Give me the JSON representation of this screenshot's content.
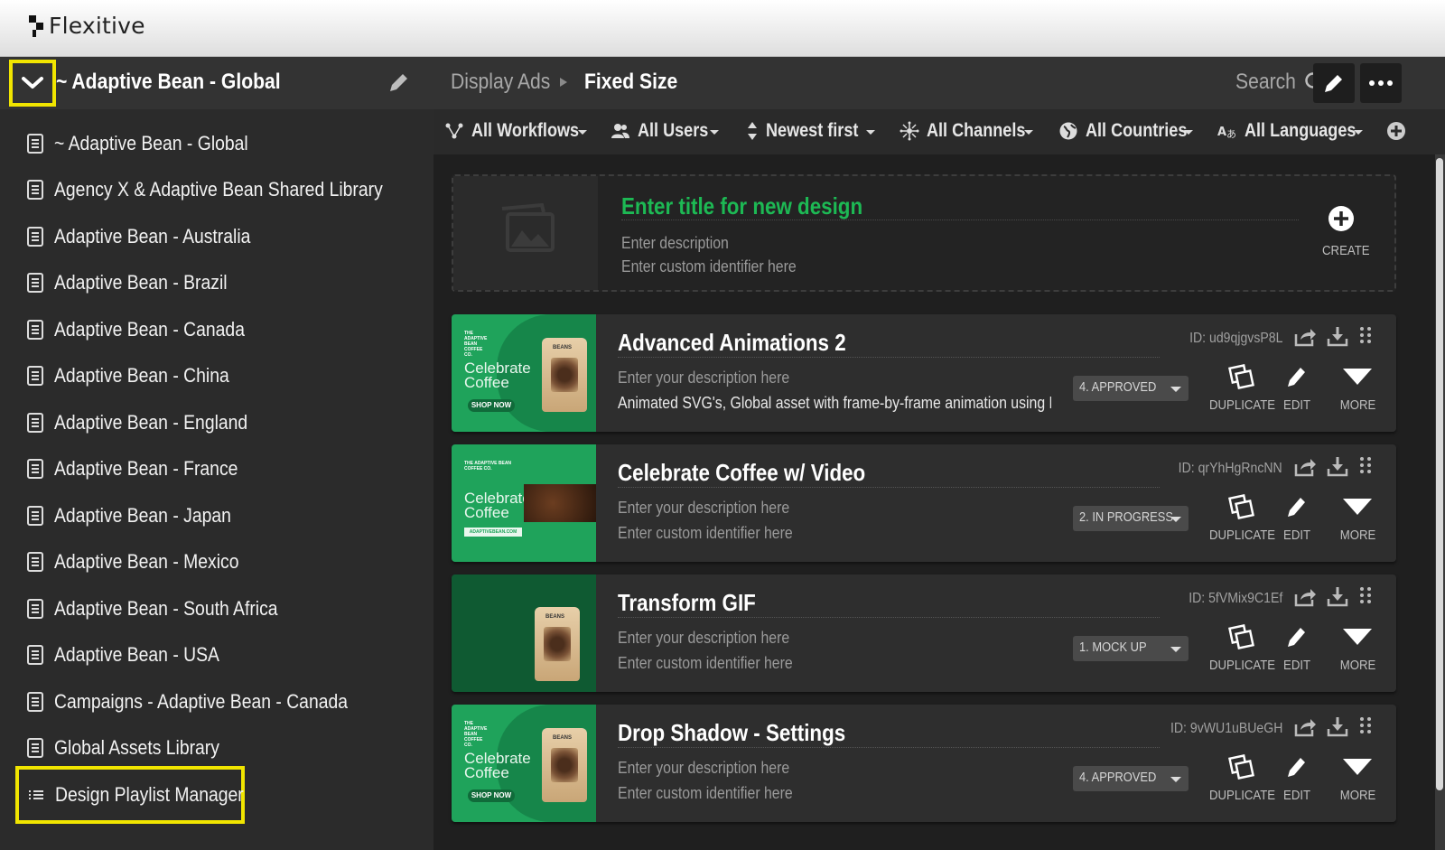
{
  "app": {
    "logo_text": "Flexitive"
  },
  "sidebar": {
    "header_title": "~ Adaptive Bean - Global",
    "items": [
      {
        "label": "~ Adaptive Bean - Global",
        "icon": "document-icon"
      },
      {
        "label": "Agency X & Adaptive Bean Shared Library",
        "icon": "document-icon"
      },
      {
        "label": "Adaptive Bean - Australia",
        "icon": "document-icon"
      },
      {
        "label": "Adaptive Bean - Brazil",
        "icon": "document-icon"
      },
      {
        "label": "Adaptive Bean - Canada",
        "icon": "document-icon"
      },
      {
        "label": "Adaptive Bean - China",
        "icon": "document-icon"
      },
      {
        "label": "Adaptive Bean - England",
        "icon": "document-icon"
      },
      {
        "label": "Adaptive Bean - France",
        "icon": "document-icon"
      },
      {
        "label": "Adaptive Bean - Japan",
        "icon": "document-icon"
      },
      {
        "label": "Adaptive Bean - Mexico",
        "icon": "document-icon"
      },
      {
        "label": "Adaptive Bean - South Africa",
        "icon": "document-icon"
      },
      {
        "label": "Adaptive Bean - USA",
        "icon": "document-icon"
      },
      {
        "label": "Campaigns - Adaptive Bean - Canada",
        "icon": "document-icon"
      },
      {
        "label": "Global Assets Library",
        "icon": "document-icon"
      },
      {
        "label": "Design Playlist Manager",
        "icon": "list-icon"
      }
    ]
  },
  "header": {
    "breadcrumb": [
      "Display Ads",
      "Fixed Size"
    ],
    "search_label": "Search"
  },
  "filters": [
    {
      "label": "All Workflows",
      "icon": "workflow-icon"
    },
    {
      "label": "All Users",
      "icon": "users-icon"
    },
    {
      "label": "Newest first",
      "icon": "sort-icon"
    },
    {
      "label": "All Channels",
      "icon": "channels-icon"
    },
    {
      "label": "All Countries",
      "icon": "globe-icon"
    },
    {
      "label": "All Languages",
      "icon": "language-icon"
    }
  ],
  "new_design": {
    "title_placeholder": "Enter title for new design",
    "description_placeholder": "Enter description",
    "identifier_placeholder": "Enter custom identifier here",
    "create_label": "CREATE"
  },
  "designs": [
    {
      "title": "Advanced Animations 2",
      "id_text": "ID: ud9qjgvsP8L",
      "description": "Enter your description here",
      "identifier": "Animated SVG's, Global asset with frame-by-frame animation using PNG",
      "status": "4. APPROVED",
      "thumb": {
        "brand": "THE ADAPTIVE BEAN COFFEE CO.",
        "headline": "Celebrate Coffee",
        "cta": "SHOP NOW"
      }
    },
    {
      "title": "Celebrate Coffee w/ Video",
      "id_text": "ID: qrYhHgRncNN",
      "description": "Enter your description here",
      "identifier": "Enter custom identifier here",
      "status": "2. IN PROGRESS",
      "thumb": {
        "brand": "THE ADAPTIVE BEAN COFFEE CO.",
        "headline": "Celebrate Coffee",
        "cta": "ADAPTIVEBEAN.COM"
      }
    },
    {
      "title": "Transform GIF",
      "id_text": "ID: 5fVMix9C1Ef",
      "description": "Enter your description here",
      "identifier": "Enter custom identifier here",
      "status": "1. MOCK UP",
      "thumb": {
        "brand": "",
        "headline": "",
        "cta": ""
      }
    },
    {
      "title": "Drop Shadow - Settings",
      "id_text": "ID: 9vWU1uBUeGH",
      "description": "Enter your description here",
      "identifier": "Enter custom identifier here",
      "status": "4. APPROVED",
      "thumb": {
        "brand": "THE ADAPTIVE BEAN COFFEE CO.",
        "headline": "Celebrate Coffee",
        "cta": "SHOP NOW"
      }
    }
  ],
  "card_actions": {
    "duplicate": "DUPLICATE",
    "edit": "EDIT",
    "more": "MORE"
  },
  "colors": {
    "accent_green": "#1db954",
    "highlight_yellow": "#f1e500",
    "sidebar_bg": "#2b2b2b",
    "main_bg": "#1f1f1f"
  }
}
